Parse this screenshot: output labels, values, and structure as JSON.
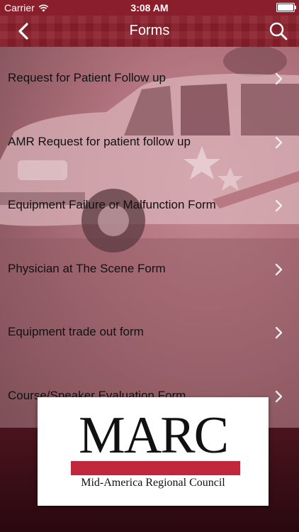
{
  "status_bar": {
    "carrier": "Carrier",
    "time": "3:08 AM",
    "wifi_icon": "wifi-icon",
    "battery_icon": "battery-icon"
  },
  "nav": {
    "title": "Forms",
    "back_icon": "chevron-left-icon",
    "search_icon": "search-icon"
  },
  "forms": [
    {
      "label": "Request for Patient Follow up"
    },
    {
      "label": "AMR  Request for patient follow up"
    },
    {
      "label": "Equipment Failure or Malfunction Form"
    },
    {
      "label": "Physician at The Scene Form"
    },
    {
      "label": "Equipment trade out form"
    },
    {
      "label": "Course/Speaker Evaluation Form"
    }
  ],
  "logo": {
    "title": "MARC",
    "subtitle": "Mid-America Regional Council"
  },
  "colors": {
    "brand": "#8a1f2b",
    "accent_red": "#c1283d",
    "footer": "#3a0f17"
  }
}
